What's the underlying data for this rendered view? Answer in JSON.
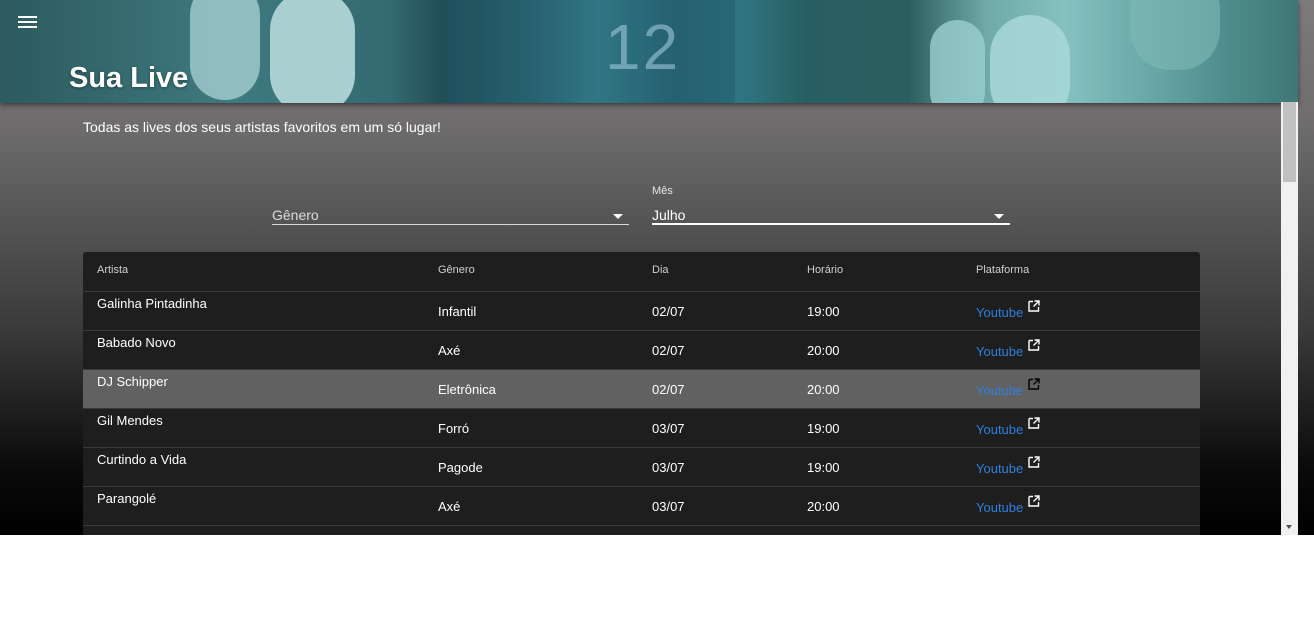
{
  "header": {
    "title": "Sua Live",
    "subtitle": "Todas as lives dos seus artistas favoritos em um só lugar!",
    "menu_icon": "menu-icon"
  },
  "filters": {
    "genero": {
      "placeholder": "Gênero",
      "value": ""
    },
    "mes": {
      "label": "Mês",
      "value": "Julho"
    }
  },
  "table": {
    "columns": [
      "Artista",
      "Gênero",
      "Dia",
      "Horário",
      "Plataforma"
    ],
    "rows": [
      {
        "artista": "Galinha Pintadinha",
        "genero": "Infantil",
        "dia": "02/07",
        "horario": "19:00",
        "plataforma": "Youtube"
      },
      {
        "artista": "Babado Novo",
        "genero": "Axé",
        "dia": "02/07",
        "horario": "20:00",
        "plataforma": "Youtube"
      },
      {
        "artista": "DJ Schipper",
        "genero": "Eletrônica",
        "dia": "02/07",
        "horario": "20:00",
        "plataforma": "Youtube"
      },
      {
        "artista": "Gil Mendes",
        "genero": "Forró",
        "dia": "03/07",
        "horario": "19:00",
        "plataforma": "Youtube"
      },
      {
        "artista": "Curtindo a Vida",
        "genero": "Pagode",
        "dia": "03/07",
        "horario": "19:00",
        "plataforma": "Youtube"
      },
      {
        "artista": "Parangolé",
        "genero": "Axé",
        "dia": "03/07",
        "horario": "20:00",
        "plataforma": "Youtube"
      }
    ],
    "highlighted_row": 2,
    "external_icon": "open-in-new-icon",
    "link_color": "#2f7fde"
  }
}
